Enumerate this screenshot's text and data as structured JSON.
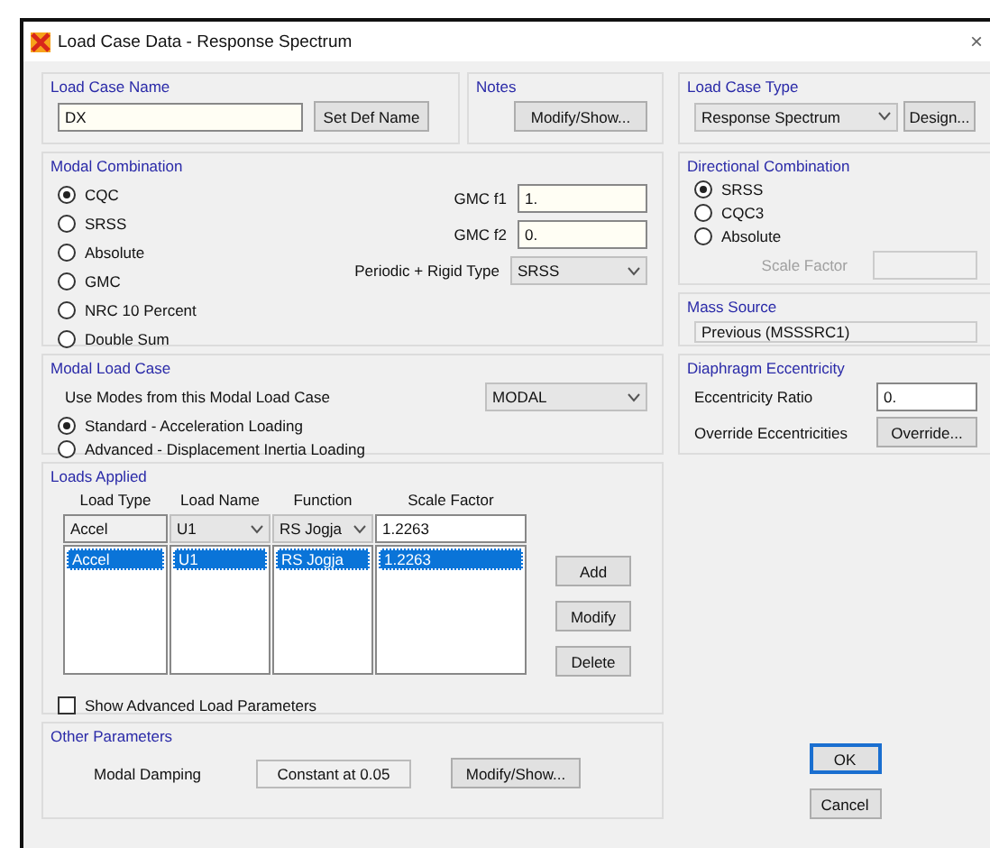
{
  "window": {
    "title": "Load Case Data - Response Spectrum",
    "close": "×"
  },
  "load_case_name": {
    "label": "Load Case Name",
    "value": "DX",
    "button": "Set Def Name"
  },
  "notes": {
    "label": "Notes",
    "button": "Modify/Show..."
  },
  "load_case_type": {
    "label": "Load Case Type",
    "value": "Response Spectrum",
    "button": "Design..."
  },
  "modal_combination": {
    "label": "Modal Combination",
    "options": [
      {
        "label": "CQC",
        "selected": true
      },
      {
        "label": "SRSS",
        "selected": false
      },
      {
        "label": "Absolute",
        "selected": false
      },
      {
        "label": "GMC",
        "selected": false
      },
      {
        "label": "NRC 10 Percent",
        "selected": false
      },
      {
        "label": "Double Sum",
        "selected": false
      }
    ],
    "gmc_f1": {
      "label": "GMC  f1",
      "value": "1."
    },
    "gmc_f2": {
      "label": "GMC  f2",
      "value": "0."
    },
    "periodic": {
      "label": "Periodic + Rigid Type",
      "value": "SRSS"
    }
  },
  "directional_combination": {
    "label": "Directional Combination",
    "options": [
      {
        "label": "SRSS",
        "selected": true
      },
      {
        "label": "CQC3",
        "selected": false
      },
      {
        "label": "Absolute",
        "selected": false
      }
    ],
    "scale_factor": {
      "label": "Scale Factor",
      "disabled": true
    }
  },
  "mass_source": {
    "label": "Mass Source",
    "value": "Previous  (MSSSRC1)"
  },
  "modal_load_case": {
    "label": "Modal Load Case",
    "use_modes": "Use Modes from this Modal Load Case",
    "value": "MODAL",
    "options": [
      {
        "label": "Standard - Acceleration Loading",
        "selected": true
      },
      {
        "label": "Advanced - Displacement Inertia Loading",
        "selected": false
      }
    ]
  },
  "diaphragm_eccentricity": {
    "label": "Diaphragm Eccentricity",
    "ratio_label": "Eccentricity Ratio",
    "ratio_value": "0.",
    "override_label": "Override Eccentricities",
    "override_button": "Override..."
  },
  "loads_applied": {
    "label": "Loads Applied",
    "columns": [
      "Load Type",
      "Load Name",
      "Function",
      "Scale Factor"
    ],
    "edit": {
      "load_type": "Accel",
      "load_name": "U1",
      "function": "RS Jogja",
      "scale_factor": "1.2263"
    },
    "rows": [
      {
        "cells": [
          "Accel",
          "U1",
          "RS Jogja",
          "1.2263"
        ],
        "selected": true
      }
    ],
    "buttons": [
      "Add",
      "Modify",
      "Delete"
    ],
    "show_advanced": {
      "label": "Show Advanced Load Parameters",
      "checked": false
    }
  },
  "other_parameters": {
    "label": "Other Parameters",
    "damping_label": "Modal Damping",
    "damping_value": "Constant at 0.05",
    "button": "Modify/Show..."
  },
  "buttons": [
    {
      "label": "OK",
      "default": true
    },
    {
      "label": "Cancel",
      "default": false
    }
  ]
}
